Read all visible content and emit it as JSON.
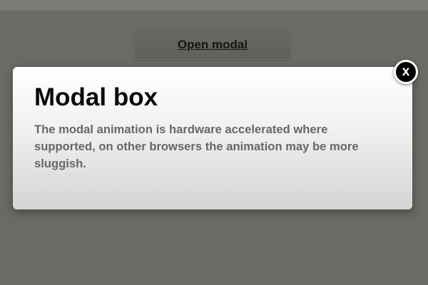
{
  "page": {
    "open_button_label": "Open modal"
  },
  "modal": {
    "title": "Modal box",
    "body": "The modal animation is hardware accelerated where supported, on other browsers the animation may be more sluggish.",
    "close_label": "x"
  },
  "colors": {
    "overlay": "#6b6a64",
    "modal_top": "#ffffff",
    "modal_bottom": "#d4d4d4",
    "title_text": "#0a0a0a",
    "body_text": "#676767",
    "close_bg": "#000000",
    "close_border": "#ffffff"
  },
  "icons": {
    "close": "close-icon"
  }
}
